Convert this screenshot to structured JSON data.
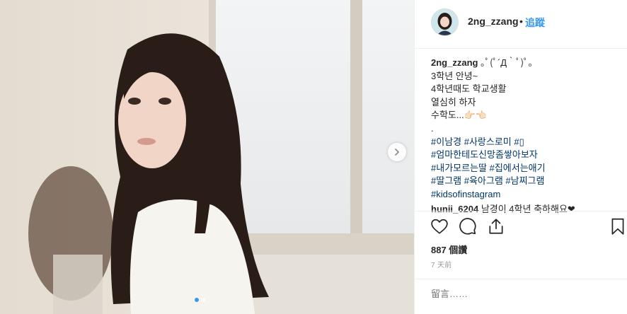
{
  "post": {
    "username": "2ng_zzang",
    "separator": "•",
    "follow_label": "追蹤",
    "carousel_dots": 2,
    "active_dot": 0
  },
  "caption": {
    "username": "2ng_zzang",
    "first_line_text": " ｡ﾟ(ﾟ´Д｀ﾟ)ﾟ｡",
    "lines": [
      "3학년 안녕~",
      "4학년때도 학교생활",
      "열심히 하자",
      "수학도...👉🏻👈🏻",
      "."
    ],
    "hashtag_lines": [
      "#이남경 #사랑스로미 #▯",
      "#엄마한테도신망좀쌓아보자",
      "#내가모르는딸 #집에서는애기",
      "#딸그램 #육아그램 #남찌그램",
      "#kidsofinstagram"
    ]
  },
  "comment": {
    "username": "hunii_6204",
    "text": " 남경이 4학년 축하해요❤"
  },
  "actions": {
    "like_icon": "heart-icon",
    "comment_icon": "comment-icon",
    "share_icon": "share-icon",
    "save_icon": "bookmark-icon"
  },
  "likes_text": "887 個讚",
  "time_text": "7 天前",
  "comment_input": {
    "placeholder": "留言……"
  },
  "colors": {
    "link": "#3897f0",
    "hashtag": "#003569",
    "border": "#efefef"
  }
}
